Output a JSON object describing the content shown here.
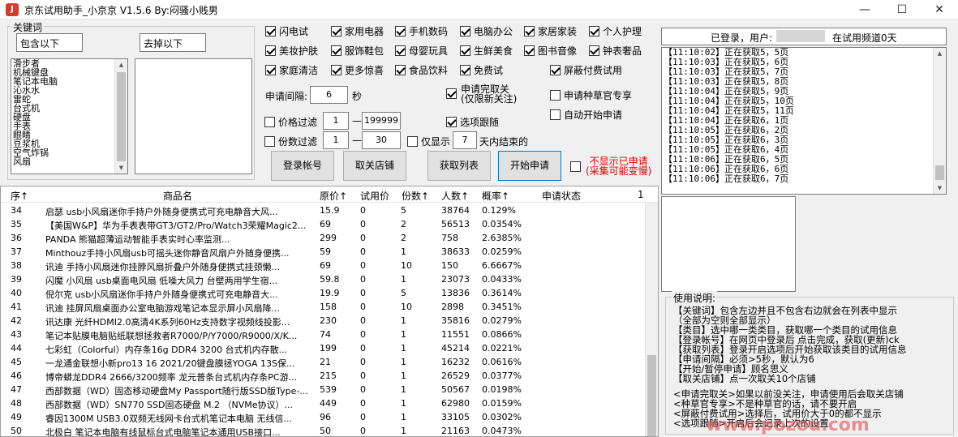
{
  "window": {
    "title": "京东试用助手_小京京 V1.5.6 By:闷骚小贱男",
    "icon": "jd-app-icon"
  },
  "keywords": {
    "legend": "关键词",
    "include_label": "包含以下",
    "exclude_label": "去掉以下",
    "include_items": [
      "滑步者",
      "机械键盘",
      "笔记本电脑",
      "沁水水",
      "雷蛇",
      "台式机",
      "硬盘",
      "手表",
      "眼睛",
      "豆浆机",
      "空气炸锅",
      "风扇"
    ]
  },
  "categories": [
    {
      "label": "闪电试",
      "checked": true
    },
    {
      "label": "家用电器",
      "checked": true
    },
    {
      "label": "手机数码",
      "checked": true
    },
    {
      "label": "电脑办公",
      "checked": true
    },
    {
      "label": "家居家装",
      "checked": true
    },
    {
      "label": "个人护理",
      "checked": true
    },
    {
      "label": "美妆护肤",
      "checked": true
    },
    {
      "label": "服饰鞋包",
      "checked": true
    },
    {
      "label": "母婴玩具",
      "checked": true
    },
    {
      "label": "生鲜美食",
      "checked": true
    },
    {
      "label": "图书音像",
      "checked": true
    },
    {
      "label": "钟表奢品",
      "checked": true
    },
    {
      "label": "家庭清洁",
      "checked": true
    },
    {
      "label": "更多惊喜",
      "checked": true
    },
    {
      "label": "食品饮料",
      "checked": true
    },
    {
      "label": "免费试",
      "checked": true
    },
    {
      "label": "屏蔽付费试用",
      "checked": true
    }
  ],
  "settings": {
    "interval_label": "申请间隔:",
    "interval_value": "6",
    "interval_unit": "秒",
    "cancel_follow_label": "申请完取关",
    "cancel_follow_sub": "(仅限新关注)",
    "seed_label": "申请种草官专享",
    "auto_start_label": "自动开始申请",
    "price_filter_label": "价格过滤",
    "price_min": "1",
    "price_max": "199999",
    "dash": "—",
    "follow_label": "选项跟随",
    "qty_filter_label": "份数过滤",
    "qty_min": "1",
    "qty_max": "30",
    "only_show_label": "仅显示",
    "only_show_days": "7",
    "days_end_label": "天内结束的"
  },
  "buttons": {
    "login": "登录帐号",
    "unfollow_shops": "取关店铺",
    "get_list": "获取列表",
    "start_apply": "开始申请",
    "hide_applied": "不显示已申请",
    "hide_applied_sub": "(采集可能变慢)"
  },
  "status": {
    "logged_in": "已登录，用户:",
    "channel": "在试用频道0天"
  },
  "log": [
    "【11:10:02】正在获取5，5页",
    "【11:10:03】正在获取5，6页",
    "【11:10:03】正在获取5，7页",
    "【11:10:03】正在获取5，8页",
    "【11:10:04】正在获取5，9页",
    "【11:10:04】正在获取5，10页",
    "【11:10:04】正在获取5，11页",
    "【11:10:04】正在获取6，1页",
    "【11:10:05】正在获取6，2页",
    "【11:10:05】正在获取6，3页",
    "【11:10:05】正在获取6，4页",
    "【11:10:06】正在获取6，5页",
    "【11:10:06】正在获取6，6页",
    "【11:10:06】正在获取6，7页"
  ],
  "table": {
    "headers": {
      "seq": "序↑",
      "name": "商品名",
      "price": "原价↑",
      "trial_price": "试用价",
      "qty": "份数↑",
      "people": "人数↑",
      "prob": "概率↑",
      "status": "申请状态",
      "count": "1"
    },
    "rows": [
      [
        "34",
        "启瑟 usb小风扇迷你手持户外随身便携式可充电静音大风...",
        "15.9",
        "0",
        "5",
        "38764",
        "0.129%"
      ],
      [
        "35",
        "【美国W&P】华为手表表带GT3/GT2/Pro/Watch3荣耀Magic2...",
        "69",
        "0",
        "2",
        "56513",
        "0.0354%"
      ],
      [
        "36",
        "PANDA 熊猫超薄运动智能手表实时心率监测...",
        "299",
        "0",
        "2",
        "758",
        "2.6385%"
      ],
      [
        "37",
        "Minthouz手持小风扇usb可摇头迷你静音风扇户外随身便携...",
        "59",
        "0",
        "1",
        "38633",
        "0.0259%"
      ],
      [
        "38",
        "讯迪 手持小风扇迷你挂脖风扇折叠户外随身便携式挂颈懒...",
        "69",
        "0",
        "10",
        "150",
        "6.6667%"
      ],
      [
        "39",
        "闪魔 小风扇 usb桌面电风扇 低噪大风力 台壁两用学生宿...",
        "59.8",
        "0",
        "1",
        "23073",
        "0.0433%"
      ],
      [
        "40",
        "倪尔克 usb小风扇迷你手持户外随身便携式可充电静音大...",
        "19.9",
        "0",
        "5",
        "13836",
        "0.3614%"
      ],
      [
        "41",
        "讯迪 挂屏风扇桌面办公室电脑游戏笔记本显示屏小风扇降...",
        "158",
        "0",
        "10",
        "2898",
        "0.3451%"
      ],
      [
        "42",
        "讯达康 光纤HDMI2.0高清4K系列60Hz支持数字视频线投影...",
        "230",
        "0",
        "1",
        "35816",
        "0.0279%"
      ],
      [
        "43",
        "笔记本贴膜电脑贴纸联想拯救者R7000/P/Y7000/R9000/X/K...",
        "74",
        "0",
        "1",
        "11551",
        "0.0866%"
      ],
      [
        "44",
        "七彩虹（Colorful）内存条16g DDR4 3200 台式机内存散...",
        "199",
        "0",
        "1",
        "45214",
        "0.0221%"
      ],
      [
        "45",
        "一龙通金联想小新pro13 16 2021/20键盘膜拯YOGA 13S保...",
        "21",
        "0",
        "1",
        "16232",
        "0.0616%"
      ],
      [
        "46",
        "博帝蟒龙DDR4 2666/3200频率 龙元普条台式机内存条PC游...",
        "215",
        "0",
        "1",
        "26529",
        "0.0377%"
      ],
      [
        "47",
        "西部数据（WD）固态移动硬盘My Passport随行版SSD版Type-...",
        "539",
        "0",
        "1",
        "50567",
        "0.0198%"
      ],
      [
        "48",
        "西部数据（WD）SN770 SSD固态硬盘 M.2 （NVMe协议）...",
        "449",
        "0",
        "1",
        "62980",
        "0.0159%"
      ],
      [
        "49",
        "睿因1300M USB3.0双频无线网卡台式机笔记本电脑 无线信...",
        "96",
        "0",
        "1",
        "33105",
        "0.0302%"
      ],
      [
        "50",
        "北极白 笔记本电脑有线鼠标台式电脑笔记本通用USB接口...",
        "50",
        "0",
        "1",
        "21163",
        "0.0473%"
      ],
      [
        "51",
        "Reletech 高速固态U盘 迷你移动硬盘 安卓手机U盘 USB3...",
        "319",
        "0",
        "2",
        "13440",
        "0.1488%"
      ]
    ]
  },
  "help": {
    "title": "使用说明:",
    "lines": [
      "【关键词】包含左边并且不包含右边就会在列表中显示",
      "（全部为空则全部显示）",
      "【类目】选中哪一类类目，获取哪一个类目的试用信息",
      "【登录帐号】在网页中登录后 点击完成，获取(更新)ck",
      "【获取列表】登录开启选项后开始获取该类目的试用信息",
      "【申请间隔】必须>5秒，默认为6",
      "【开始/暂停申请】顾名思义",
      "【取关店铺】点一次取关10个店铺",
      "",
      "<申请完取关>如果以前没关注，申请使用后会取关店铺",
      "<种草官专享>不是种草官的话，请不要开启",
      "<屏蔽付费试用>选择后，试用价大于0的都不显示",
      "<选项跟随>开启后会记录上次的设置"
    ]
  },
  "watermark": "www.pozou.com"
}
